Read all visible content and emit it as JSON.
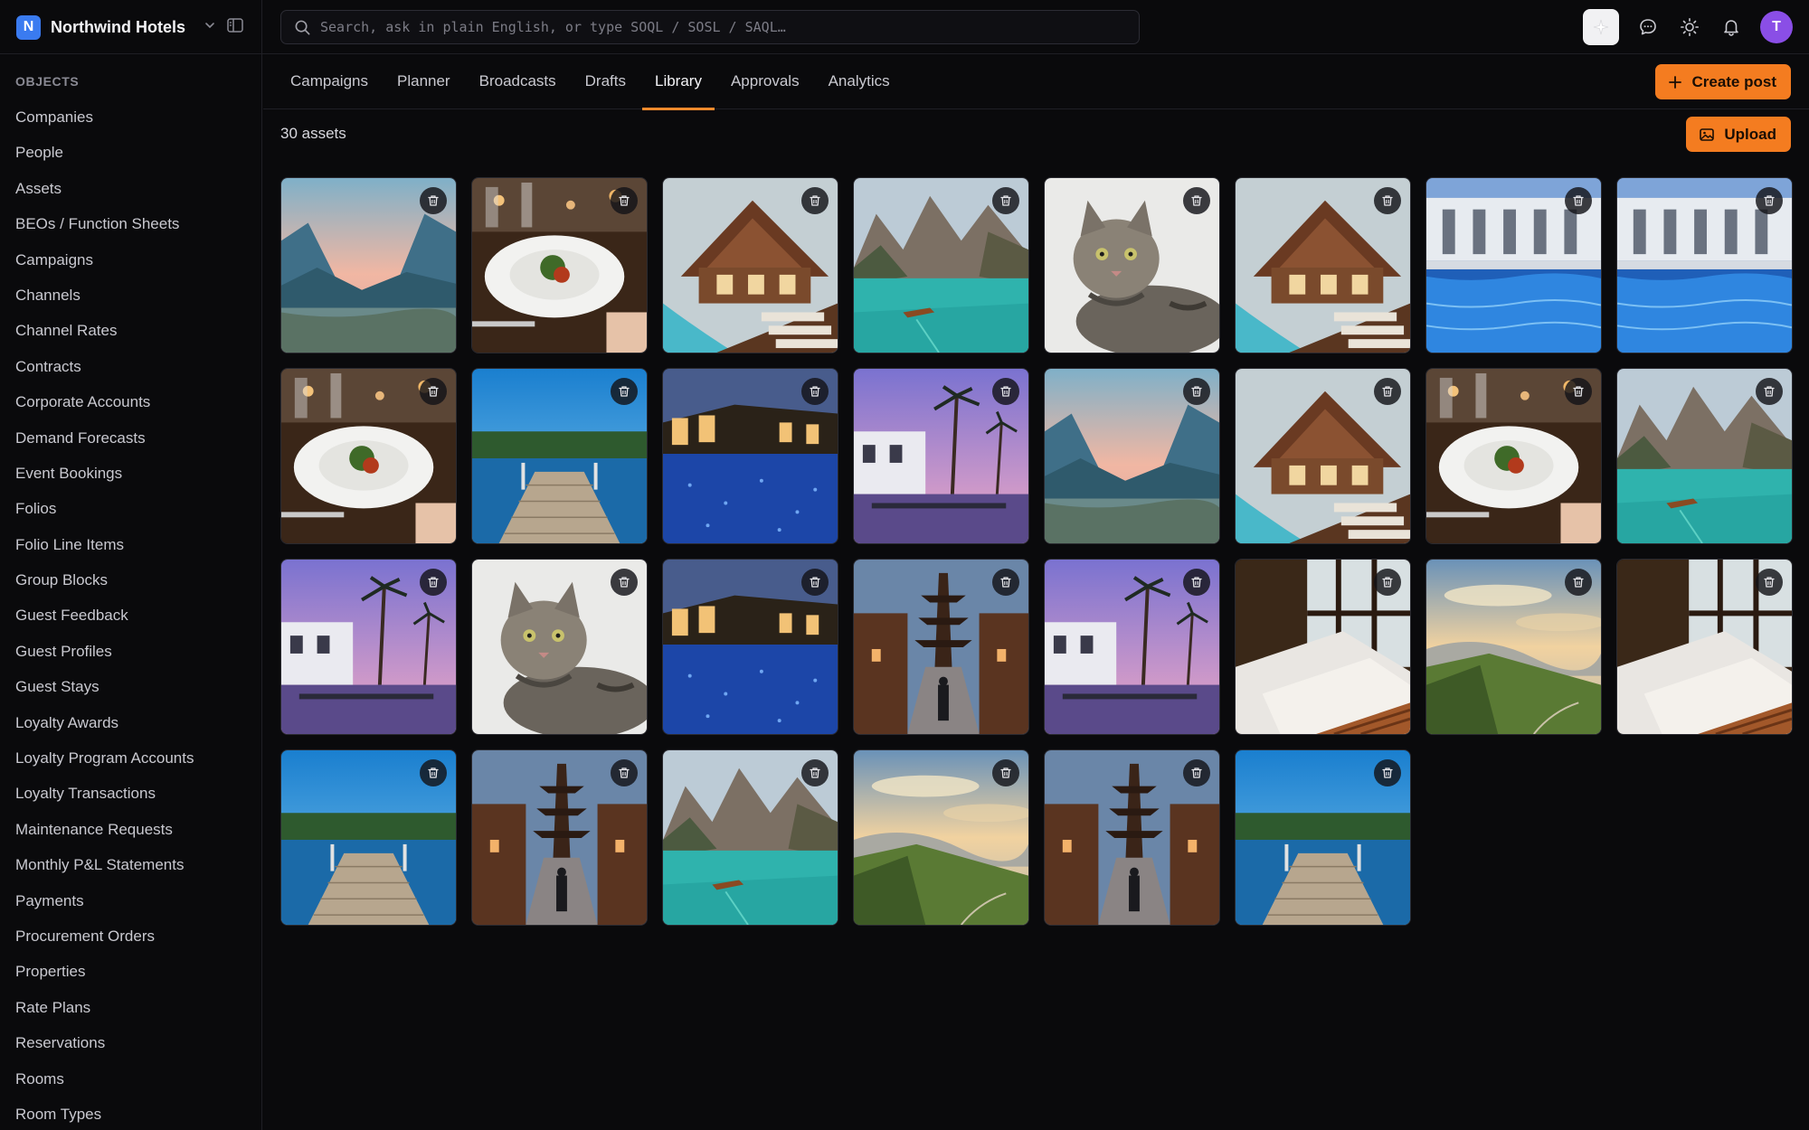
{
  "app": {
    "logo_letter": "N",
    "name": "Northwind Hotels",
    "avatar_letter": "T"
  },
  "search": {
    "placeholder": "Search, ask in plain English, or type SOQL / SOSL / SAQL…"
  },
  "sidebar": {
    "heading": "OBJECTS",
    "items": [
      "Companies",
      "People",
      "Assets",
      "BEOs / Function Sheets",
      "Campaigns",
      "Channels",
      "Channel Rates",
      "Contracts",
      "Corporate Accounts",
      "Demand Forecasts",
      "Event Bookings",
      "Folios",
      "Folio Line Items",
      "Group Blocks",
      "Guest Feedback",
      "Guest Profiles",
      "Guest Stays",
      "Loyalty Awards",
      "Loyalty Program Accounts",
      "Loyalty Transactions",
      "Maintenance Requests",
      "Monthly P&L Statements",
      "Payments",
      "Procurement Orders",
      "Properties",
      "Rate Plans",
      "Reservations",
      "Rooms",
      "Room Types"
    ]
  },
  "tabs": [
    {
      "label": "Campaigns",
      "active": false
    },
    {
      "label": "Planner",
      "active": false
    },
    {
      "label": "Broadcasts",
      "active": false
    },
    {
      "label": "Drafts",
      "active": false
    },
    {
      "label": "Library",
      "active": true
    },
    {
      "label": "Approvals",
      "active": false
    },
    {
      "label": "Analytics",
      "active": false
    }
  ],
  "actions": {
    "create_post": "Create post",
    "upload": "Upload"
  },
  "library": {
    "asset_count": "30 assets",
    "assets": [
      "mountain-valley",
      "dining-plate",
      "chalet-pool",
      "alpine-lake",
      "tabby-cat",
      "chalet-pool",
      "hotel-pool",
      "hotel-pool",
      "dining-plate",
      "lake-dock",
      "night-pool",
      "palm-resort",
      "mountain-valley",
      "chalet-pool",
      "dining-plate",
      "alpine-lake",
      "palm-resort",
      "tabby-cat",
      "night-pool",
      "pagoda-street",
      "palm-resort",
      "bedroom-window",
      "green-cliffs",
      "bedroom-window",
      "lake-dock",
      "pagoda-street",
      "alpine-lake",
      "green-cliffs",
      "pagoda-street",
      "lake-dock"
    ]
  },
  "colors": {
    "accent": "#f47c20",
    "brand": "#3a7bf0",
    "avatar": "#8a4ee6"
  }
}
